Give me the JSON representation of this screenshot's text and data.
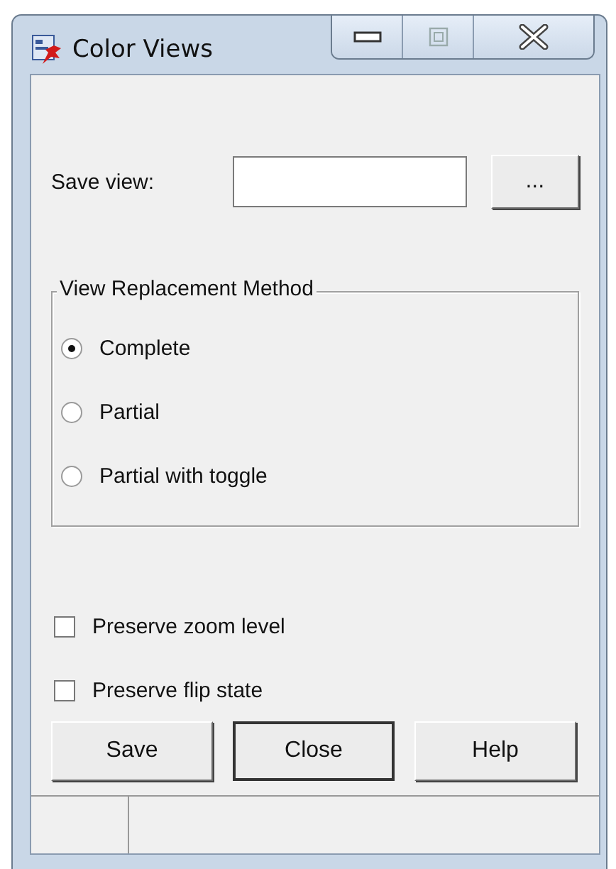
{
  "window": {
    "title": "Color Views"
  },
  "save_view": {
    "label": "Save view:",
    "browse": "..."
  },
  "group": {
    "title": "View Replacement Method",
    "options": [
      {
        "label": "Complete",
        "selected": true
      },
      {
        "label": "Partial",
        "selected": false
      },
      {
        "label": "Partial with toggle",
        "selected": false
      }
    ]
  },
  "checkboxes": [
    {
      "label": "Preserve zoom level",
      "checked": false
    },
    {
      "label": "Preserve flip state",
      "checked": false
    }
  ],
  "buttons": [
    {
      "label": "Save",
      "default": false
    },
    {
      "label": "Close",
      "default": true
    },
    {
      "label": "Help",
      "default": false
    }
  ]
}
